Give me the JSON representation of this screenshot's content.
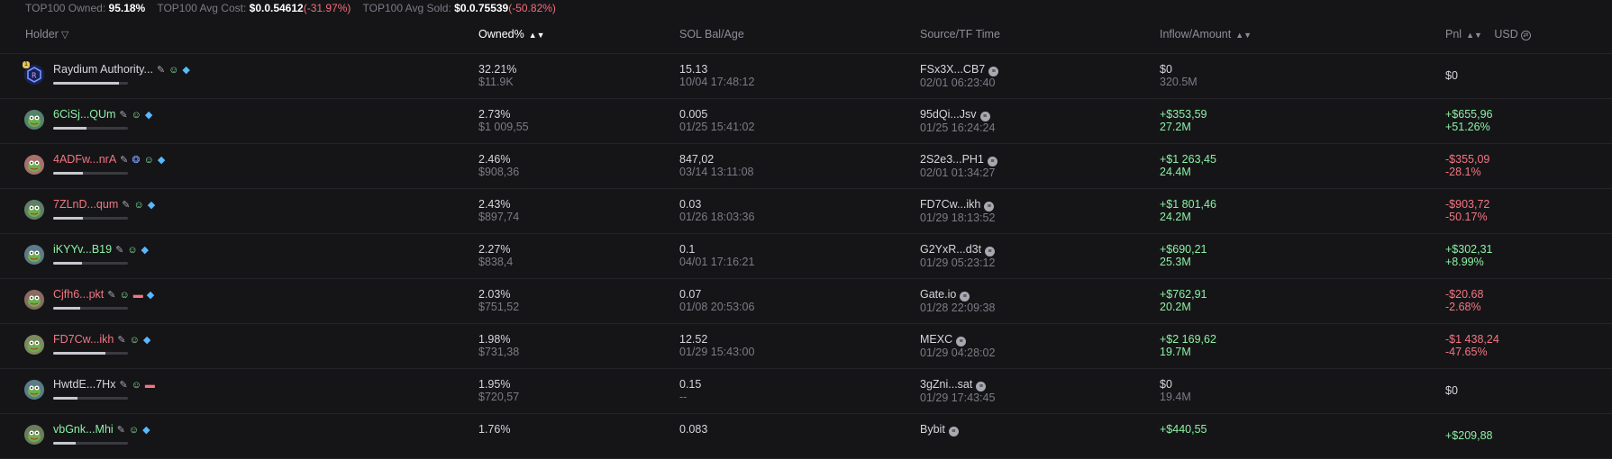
{
  "summary": {
    "owned_label": "TOP100 Owned:",
    "owned_value": "95.18%",
    "avg_cost_label": "TOP100 Avg Cost:",
    "avg_cost_value": "$0.0.54612",
    "avg_cost_change": "(-31.97%)",
    "avg_sold_label": "TOP100 Avg Sold:",
    "avg_sold_value": "$0.0.75539",
    "avg_sold_change": "(-50.82%)"
  },
  "columns": {
    "holder": "Holder",
    "owned": "Owned%",
    "sol_bal": "SOL Bal/Age",
    "source": "Source/TF Time",
    "inflow": "Inflow/Amount",
    "pnl": "Pnl",
    "usd": "USD"
  },
  "colors": {
    "background": "#151517",
    "positive": "#8cf0a6",
    "negative": "#f37683",
    "muted": "#7b7c85",
    "diamond": "#59b8ff"
  },
  "rows": [
    {
      "holder": "Raydium Authority...",
      "tags": [
        "pen-icon",
        "person-icon",
        "diamond-icon"
      ],
      "owned_pct": "32.21%",
      "owned_usd": "$11.9K",
      "sol_bal": "15.13",
      "sol_age": "10/04 17:48:12",
      "source": "FSx3X...CB7",
      "source_time": "02/01 06:23:40",
      "inflow": "$0",
      "amount": "320.5M",
      "pnl": "$0",
      "pnl_pct": ""
    },
    {
      "holder": "6CiSj...QUm",
      "tags": [
        "pen-icon",
        "person-icon",
        "diamond-icon"
      ],
      "owned_pct": "2.73%",
      "owned_usd": "$1 009,55",
      "sol_bal": "0.005",
      "sol_age": "01/25 15:41:02",
      "source": "95dQi...Jsv",
      "source_time": "01/25 16:24:24",
      "inflow": "+$353,59",
      "amount": "27.2M",
      "pnl": "+$655,96",
      "pnl_pct": "+51.26%"
    },
    {
      "holder": "4ADFw...nrA",
      "tags": [
        "pen-icon",
        "ufo-icon",
        "person-icon",
        "diamond-icon"
      ],
      "owned_pct": "2.46%",
      "owned_usd": "$908,36",
      "sol_bal": "847,02",
      "sol_age": "03/14 13:11:08",
      "source": "2S2e3...PH1",
      "source_time": "02/01 01:34:27",
      "inflow": "+$1 263,45",
      "amount": "24.4M",
      "pnl": "-$355,09",
      "pnl_pct": "-28.1%"
    },
    {
      "holder": "7ZLnD...qum",
      "tags": [
        "pen-icon",
        "person-icon",
        "diamond-icon"
      ],
      "owned_pct": "2.43%",
      "owned_usd": "$897,74",
      "sol_bal": "0.03",
      "sol_age": "01/26 18:03:36",
      "source": "FD7Cw...ikh",
      "source_time": "01/29 18:13:52",
      "inflow": "+$1 801,46",
      "amount": "24.2M",
      "pnl": "-$903,72",
      "pnl_pct": "-50.17%"
    },
    {
      "holder": "iKYYv...B19",
      "tags": [
        "pen-icon",
        "person-icon",
        "diamond-icon"
      ],
      "owned_pct": "2.27%",
      "owned_usd": "$838,4",
      "sol_bal": "0.1",
      "sol_age": "04/01 17:16:21",
      "source": "G2YxR...d3t",
      "source_time": "01/29 05:23:12",
      "inflow": "+$690,21",
      "amount": "25.3M",
      "pnl": "+$302,31",
      "pnl_pct": "+8.99%"
    },
    {
      "holder": "Cjfh6...pkt",
      "tags": [
        "pen-icon",
        "person-icon",
        "pill-icon",
        "diamond-icon"
      ],
      "owned_pct": "2.03%",
      "owned_usd": "$751,52",
      "sol_bal": "0.07",
      "sol_age": "01/08 20:53:06",
      "source": "Gate.io",
      "source_time": "01/28 22:09:38",
      "inflow": "+$762,91",
      "amount": "20.2M",
      "pnl": "-$20.68",
      "pnl_pct": "-2.68%"
    },
    {
      "holder": "FD7Cw...ikh",
      "tags": [
        "pen-icon",
        "person-icon",
        "diamond-icon"
      ],
      "owned_pct": "1.98%",
      "owned_usd": "$731,38",
      "sol_bal": "12.52",
      "sol_age": "01/29 15:43:00",
      "source": "MEXC",
      "source_time": "01/29 04:28:02",
      "inflow": "+$2 169,62",
      "amount": "19.7M",
      "pnl": "-$1 438,24",
      "pnl_pct": "-47.65%"
    },
    {
      "holder": "HwtdE...7Hx",
      "tags": [
        "pen-icon",
        "person-icon",
        "pill-icon"
      ],
      "owned_pct": "1.95%",
      "owned_usd": "$720,57",
      "sol_bal": "0.15",
      "sol_age": "--",
      "source": "3gZni...sat",
      "source_time": "01/29 17:43:45",
      "inflow": "$0",
      "amount": "19.4M",
      "pnl": "$0",
      "pnl_pct": ""
    },
    {
      "holder": "vbGnk...Mhi",
      "tags": [
        "pen-icon",
        "person-icon",
        "diamond-icon"
      ],
      "owned_pct": "1.76%",
      "owned_usd": "",
      "sol_bal": "0.083",
      "sol_age": "",
      "source": "Bybit",
      "source_time": "",
      "inflow": "+$440,55",
      "amount": "",
      "pnl": "+$209,88",
      "pnl_pct": ""
    }
  ]
}
